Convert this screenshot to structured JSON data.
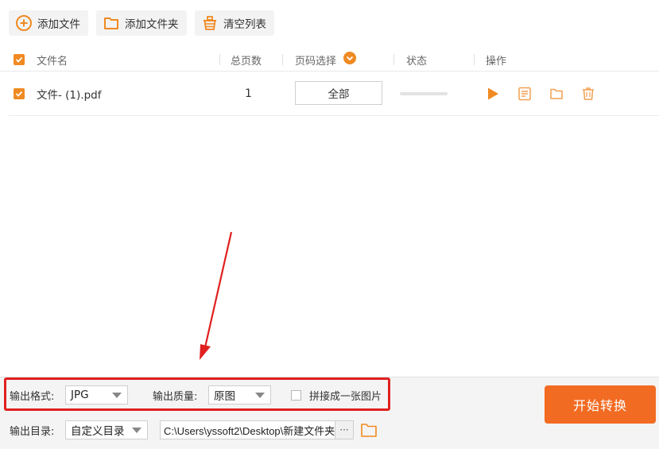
{
  "toolbar": {
    "add_file": "添加文件",
    "add_folder": "添加文件夹",
    "clear_list": "清空列表"
  },
  "table": {
    "headers": {
      "filename": "文件名",
      "total_pages": "总页数",
      "page_select": "页码选择",
      "status": "状态",
      "actions": "操作"
    },
    "rows": [
      {
        "checked": true,
        "filename": "文件- (1).pdf",
        "total_pages": "1",
        "page_select": "全部",
        "progress": 0
      }
    ]
  },
  "bottom": {
    "output_format_label": "输出格式:",
    "output_format_value": "JPG",
    "output_quality_label": "输出质量:",
    "output_quality_value": "原图",
    "merge_label": "拼接成一张图片",
    "merge_checked": false,
    "output_dir_label": "输出目录:",
    "output_dir_mode": "自定义目录",
    "output_path": "C:\\Users\\yssoft2\\Desktop\\新建文件夹\\",
    "ellipsis": "···",
    "start_button": "开始转换"
  },
  "colors": {
    "accent": "#f08a22",
    "start_button": "#f26b22",
    "highlight": "#e0201f"
  },
  "icons": [
    "plus-circle-icon",
    "folder-icon",
    "basket-icon",
    "checkbox-icon",
    "chevron-down-icon",
    "play-icon",
    "document-icon",
    "folder-icon",
    "trash-icon",
    "arrow-annotation"
  ]
}
